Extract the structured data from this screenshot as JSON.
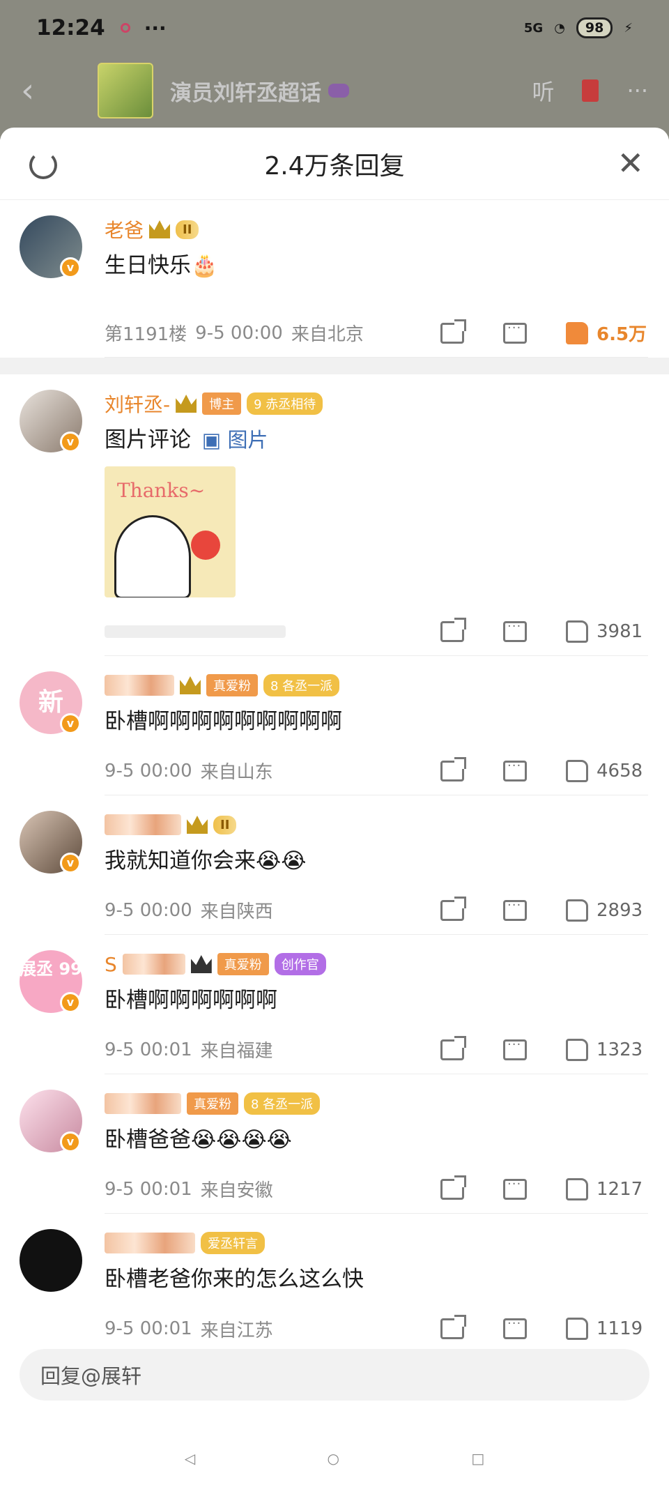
{
  "status": {
    "time": "12:24",
    "network": "5G",
    "battery": "98"
  },
  "topbar": {
    "title": "演员刘轩丞超话",
    "listen_label": "听"
  },
  "sheet": {
    "title": "2.4万条回复"
  },
  "comments": [
    {
      "name": "老爸",
      "level": "II",
      "text": "生日快乐🎂",
      "floor": "第1191楼",
      "time": "9-5 00:00",
      "location": "来自北京",
      "likes": "6.5万"
    },
    {
      "name": "刘轩丞-",
      "tags": [
        "博主",
        "9 赤丞相待"
      ],
      "text": "图片评论",
      "pic_label": "图片",
      "image_text": "Thanks~",
      "likes": "3981"
    },
    {
      "tags": [
        "真爱粉",
        "8 各丞一派"
      ],
      "text": "卧槽啊啊啊啊啊啊啊啊啊",
      "avatar_text": "新",
      "time": "9-5 00:00",
      "location": "来自山东",
      "likes": "4658"
    },
    {
      "level": "II",
      "text": "我就知道你会来😭😭",
      "time": "9-5 00:00",
      "location": "来自陕西",
      "likes": "2893"
    },
    {
      "tags": [
        "真爱粉",
        "创作官"
      ],
      "name_partial": "S",
      "text": "卧槽啊啊啊啊啊啊",
      "avatar_text": "展丞 99",
      "time": "9-5 00:01",
      "location": "来自福建",
      "likes": "1323"
    },
    {
      "tags": [
        "真爱粉",
        "8 各丞一派"
      ],
      "text": "卧槽爸爸😭😭😭😭",
      "time": "9-5 00:01",
      "location": "来自安徽",
      "likes": "1217"
    },
    {
      "tags": [
        "爱丞轩言"
      ],
      "text": "卧槽老爸你来的怎么这么快",
      "time": "9-5 00:01",
      "location": "来自江苏",
      "likes": "1119"
    }
  ],
  "reply": {
    "placeholder": "回复@展轩"
  },
  "colors": {
    "accent": "#e8862c",
    "link": "#3d6eb5"
  }
}
